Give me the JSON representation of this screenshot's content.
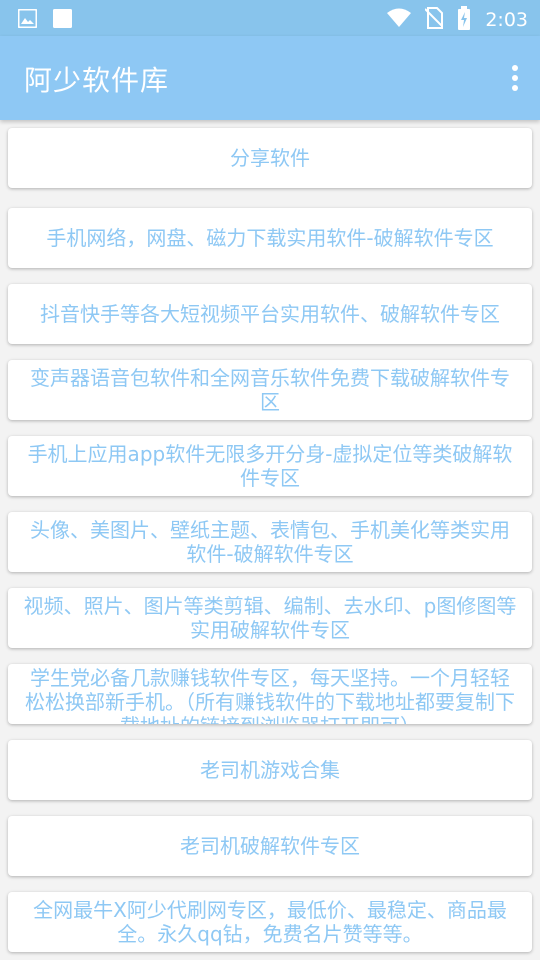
{
  "status_bar": {
    "time": "2:03",
    "left_icons": [
      "image-icon",
      "square-icon"
    ],
    "right_icons": [
      "wifi-icon",
      "no-sim-icon",
      "battery-charging-icon"
    ]
  },
  "app_bar": {
    "title": "阿少软件库",
    "menu_icon": "more-vert-icon",
    "background": "#8ec8f4"
  },
  "items": [
    {
      "label": "分享软件"
    },
    {
      "label": "手机网络，网盘、磁力下载实用软件-破解软件专区"
    },
    {
      "label": "抖音快手等各大短视频平台实用软件、破解软件专区"
    },
    {
      "label": "变声器语音包软件和全网音乐软件免费下载破解软件专区"
    },
    {
      "label": "手机上应用app软件无限多开分身-虚拟定位等类破解软件专区"
    },
    {
      "label": "头像、美图片、壁纸主题、表情包、手机美化等类实用软件-破解软件专区"
    },
    {
      "label": "视频、照片、图片等类剪辑、编制、去水印、p图修图等实用破解软件专区"
    },
    {
      "label": "学生党必备几款赚钱软件专区，每天坚持。一个月轻轻松松换部新手机。（所有赚钱软件的下载地址都要复制下载地址的链接到浏览器打开即可）"
    },
    {
      "label": "老司机游戏合集"
    },
    {
      "label": "老司机破解软件专区"
    },
    {
      "label": "全网最牛X阿少代刷网专区，最低价、最稳定、商品最全。永久qq钻，免费名片赞等等。"
    }
  ],
  "colors": {
    "accent": "#8ec8f4",
    "card": "#ffffff",
    "page": "#f3f3f3"
  }
}
